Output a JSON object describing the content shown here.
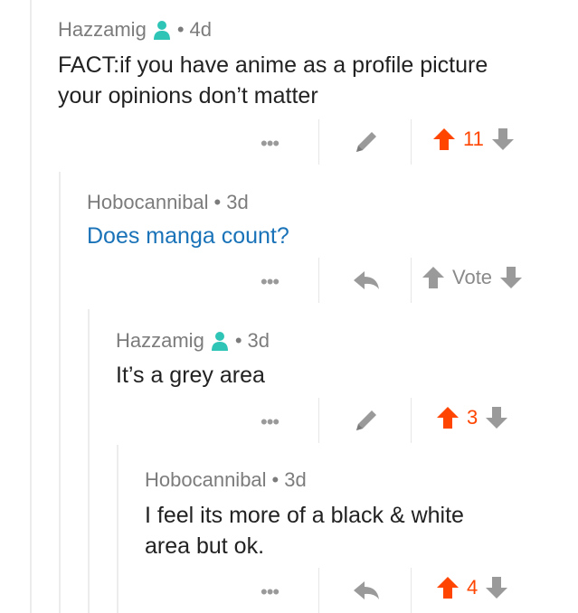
{
  "comments": [
    {
      "username": "Hazzamig",
      "has_user_icon": true,
      "separator": "•",
      "age": "4d",
      "body_lines": [
        "FACT:if you have anime as a profile picture",
        "your opinions don’t matter"
      ],
      "more": "•••",
      "action": "edit",
      "score": "11",
      "score_state": "upvoted"
    },
    {
      "username": "Hobocannibal",
      "has_user_icon": false,
      "separator": "•",
      "age": "3d",
      "body_lines": [
        "Does manga count?"
      ],
      "more": "•••",
      "action": "reply",
      "score": "Vote",
      "score_state": "neutral"
    },
    {
      "username": "Hazzamig",
      "has_user_icon": true,
      "separator": "•",
      "age": "3d",
      "body_lines": [
        "It’s a grey area"
      ],
      "more": "•••",
      "action": "edit",
      "score": "3",
      "score_state": "upvoted"
    },
    {
      "username": "Hobocannibal",
      "has_user_icon": false,
      "separator": "•",
      "age": "3d",
      "body_lines": [
        "I feel its more of a black & white",
        "area but ok."
      ],
      "more": "•••",
      "action": "reply",
      "score": "4",
      "score_state": "upvoted"
    }
  ],
  "colors": {
    "upvote": "#ff4500",
    "neutral_arrow": "#8a8a8a",
    "user_icon": "#2ec4b6",
    "link": "#1a73b8"
  }
}
